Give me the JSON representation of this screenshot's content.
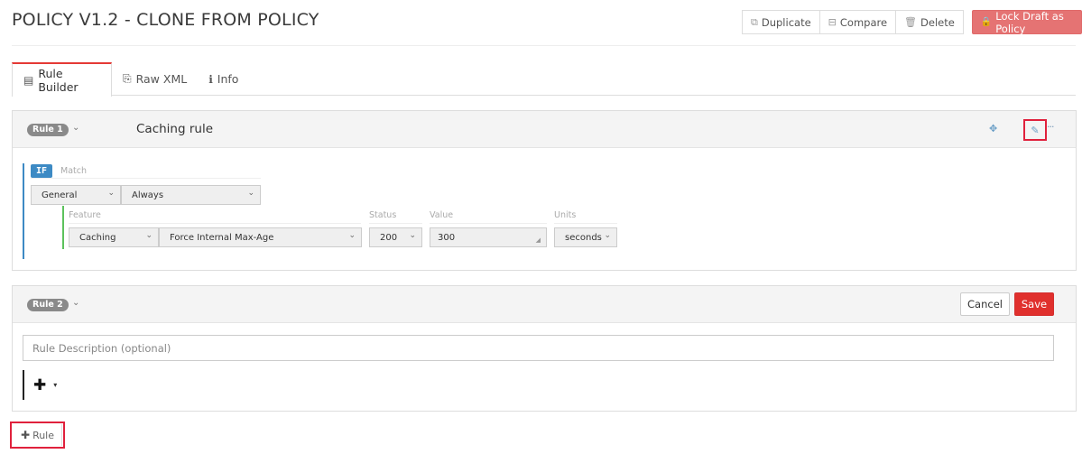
{
  "header": {
    "title": "POLICY V1.2 - CLONE FROM POLICY",
    "actions": {
      "duplicate": {
        "label": "Duplicate",
        "icon": "copy-icon",
        "glyph": "⧉"
      },
      "compare": {
        "label": "Compare",
        "icon": "compare-icon",
        "glyph": "⊟"
      },
      "delete": {
        "label": "Delete",
        "icon": "trash-icon",
        "glyph": "🗑"
      },
      "lock": {
        "label": "Lock Draft as Policy",
        "icon": "lock-icon",
        "glyph": "🔒",
        "color": "#e57373"
      }
    }
  },
  "tabs": [
    {
      "label": "Rule Builder",
      "icon": "list-icon",
      "glyph": "▤",
      "active": true
    },
    {
      "label": "Raw XML",
      "icon": "code-file-icon",
      "glyph": "⎘",
      "active": false
    },
    {
      "label": "Info",
      "icon": "info-icon",
      "glyph": "ℹ",
      "active": false
    }
  ],
  "rules": [
    {
      "badge": "Rule 1",
      "name": "Caching rule",
      "caret": "⌄",
      "actions": {
        "move_glyph": "✥",
        "edit_glyph": "✎",
        "more_glyph": "···"
      },
      "condition": {
        "keyword": "IF",
        "match_label": "Match",
        "category": "General",
        "operator": "Always"
      },
      "feature": {
        "labels": {
          "feature": "Feature",
          "status": "Status",
          "value": "Value",
          "units": "Units"
        },
        "category": "Caching",
        "name": "Force Internal Max-Age",
        "status": "200",
        "value": "300",
        "units": "seconds"
      }
    },
    {
      "badge": "Rule 2",
      "caret": "⌄",
      "description_placeholder": "Rule Description (optional)",
      "description_value": "",
      "add_condition_glyph": "✚",
      "add_condition_caret": "▾",
      "cancel_label": "Cancel",
      "save_label": "Save",
      "save_color": "#e0302d"
    }
  ],
  "footer": {
    "add_rule_label": "Rule",
    "add_rule_glyph": "✚"
  },
  "chevron": "⌄"
}
